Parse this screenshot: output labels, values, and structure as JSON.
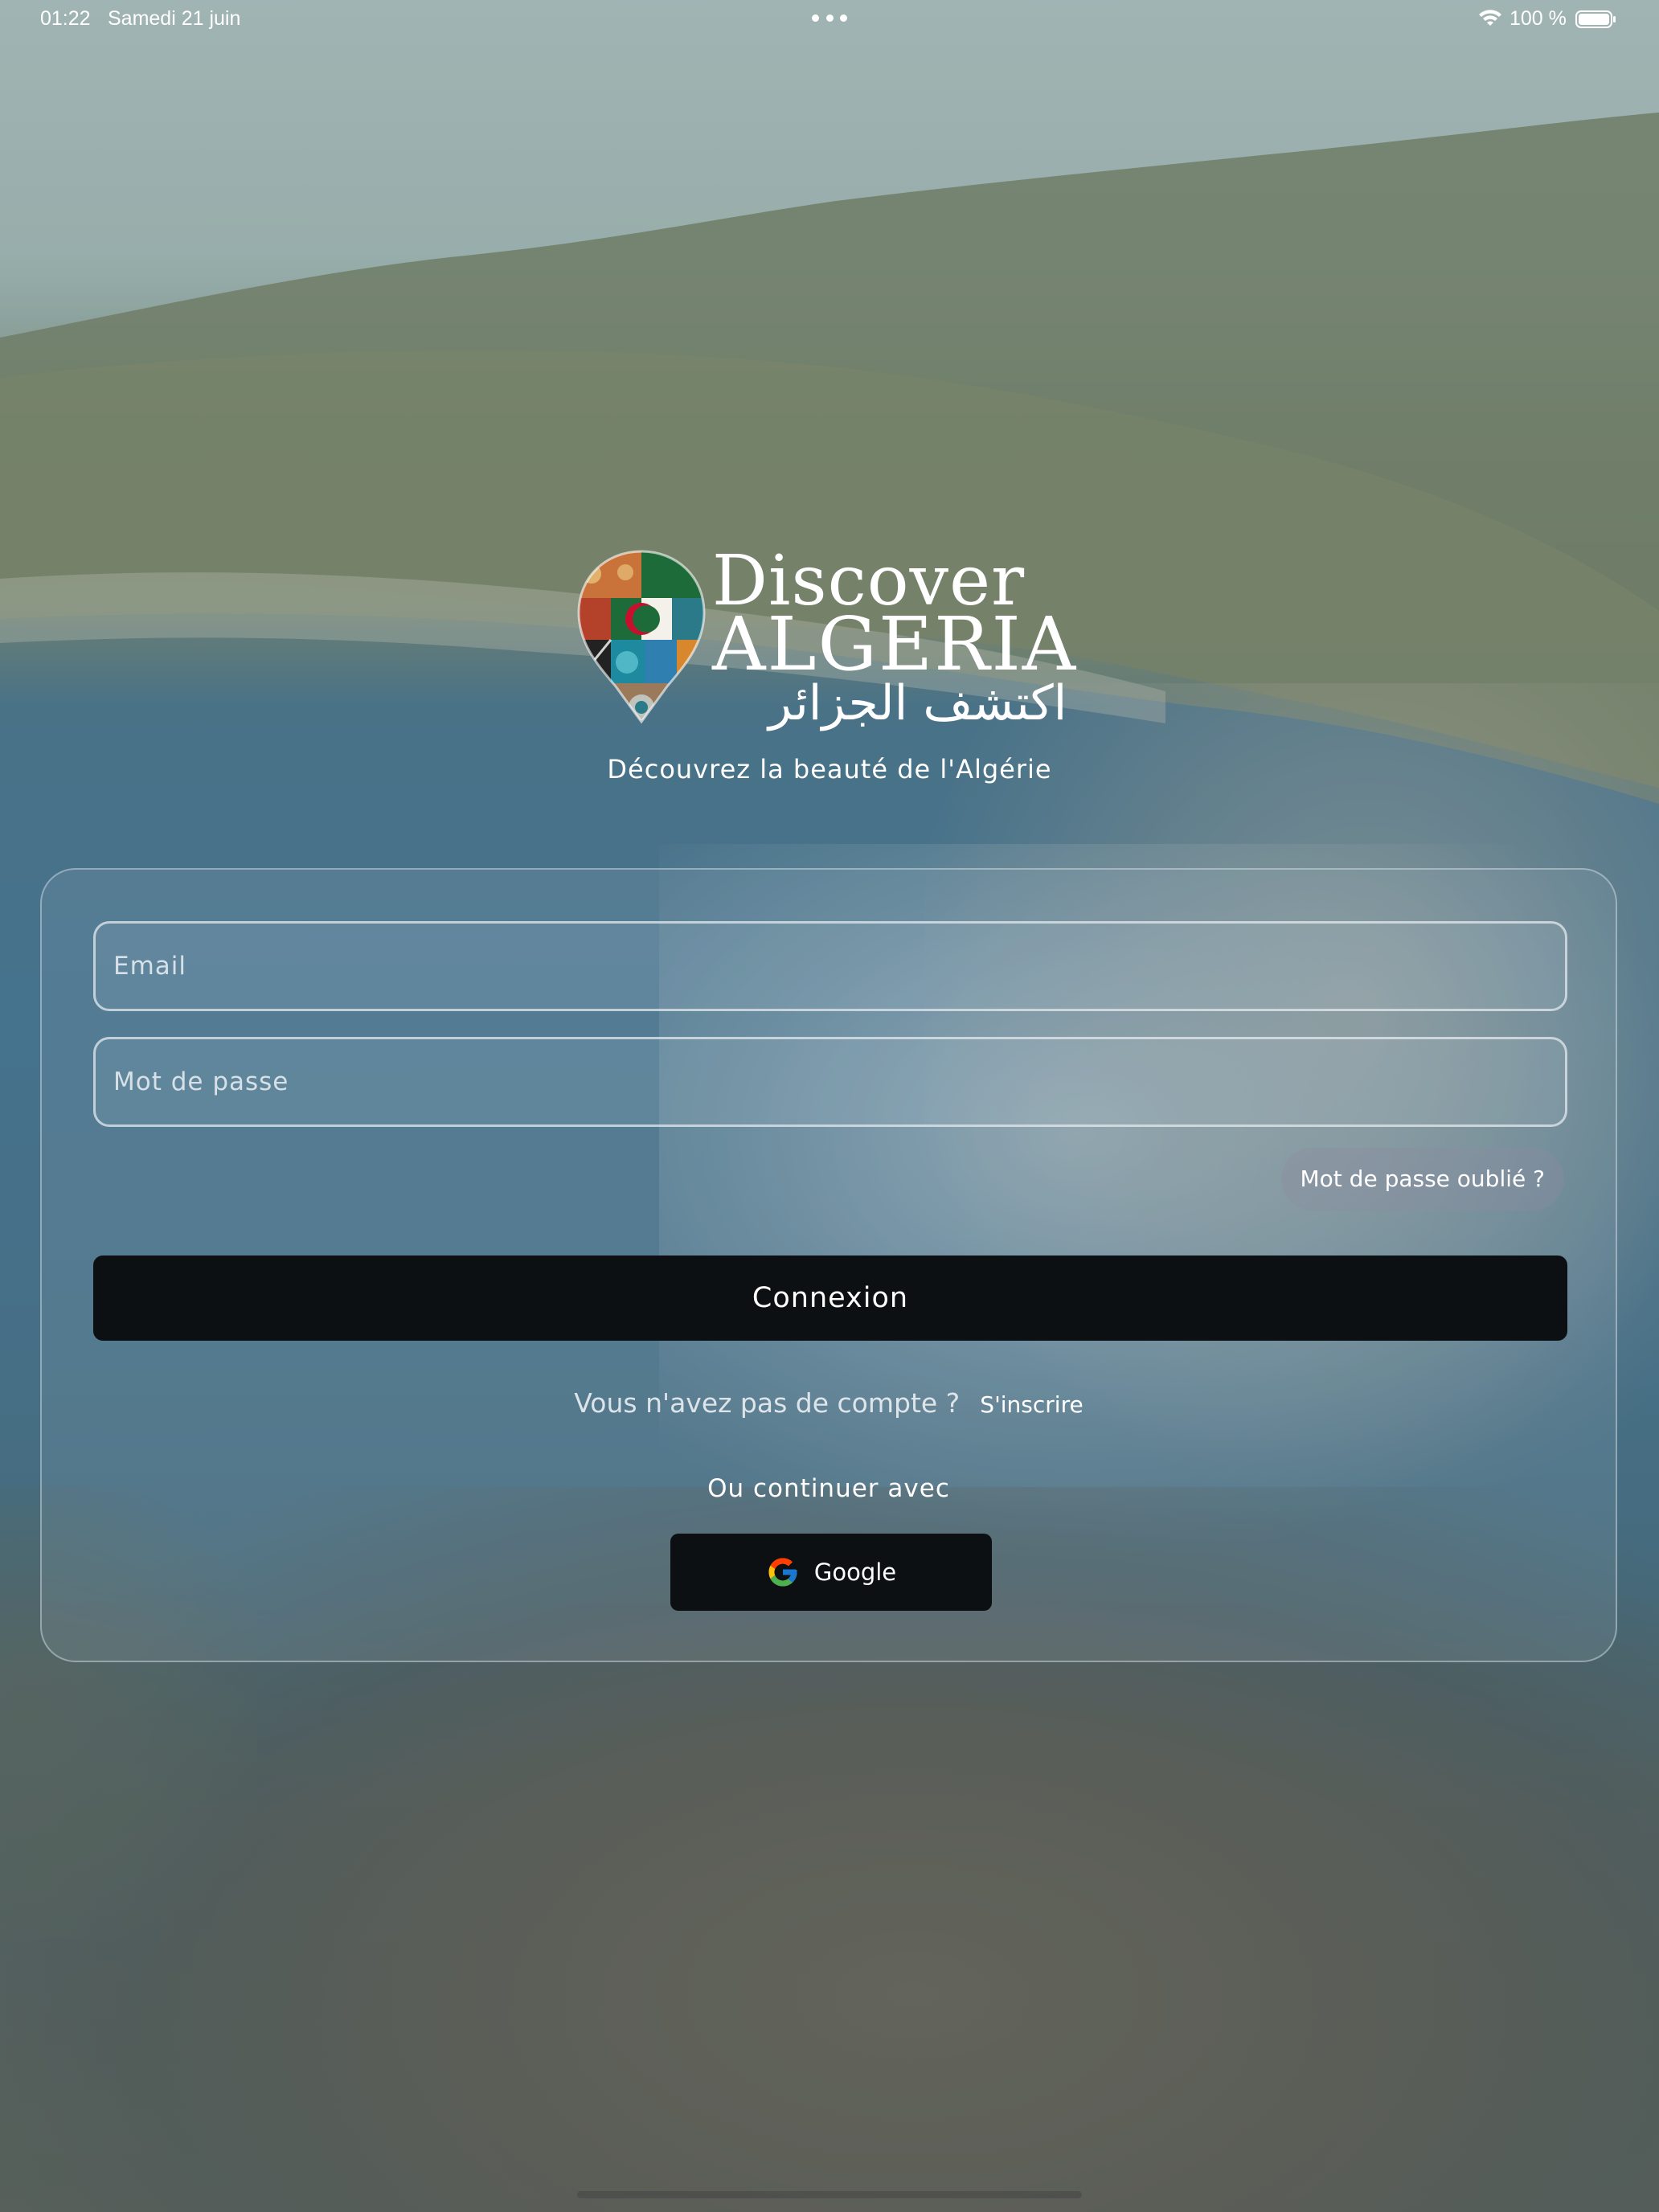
{
  "status_bar": {
    "time": "01:22",
    "date": "Samedi 21 juin",
    "battery": "100 %",
    "icons": [
      "wifi-icon",
      "battery-icon",
      "more-dots-icon"
    ]
  },
  "brand": {
    "title_line1": "Discover",
    "title_line2": "ALGERIA",
    "title_arabic": "اكتشف الجزائر",
    "tagline": "Découvrez la beauté de l'Algérie",
    "logo_icon": "map-pin-mosaic-logo",
    "colors": {
      "flag_green": "#1e6b3a",
      "flag_red": "#c8102e",
      "accent_orange": "#d9782d"
    }
  },
  "login_form": {
    "email_placeholder": "Email",
    "email_value": "",
    "password_placeholder": "Mot de passe",
    "password_value": "",
    "forgot_password_label": "Mot de passe oublié ?",
    "submit_label": "Connexion",
    "signup_prompt": "Vous n'avez pas de compte ?",
    "signup_link": "S'inscrire",
    "continue_with_label": "Ou continuer avec",
    "google_label": "Google",
    "google_icon": "google-g-icon",
    "button_color": "#0d1013"
  }
}
